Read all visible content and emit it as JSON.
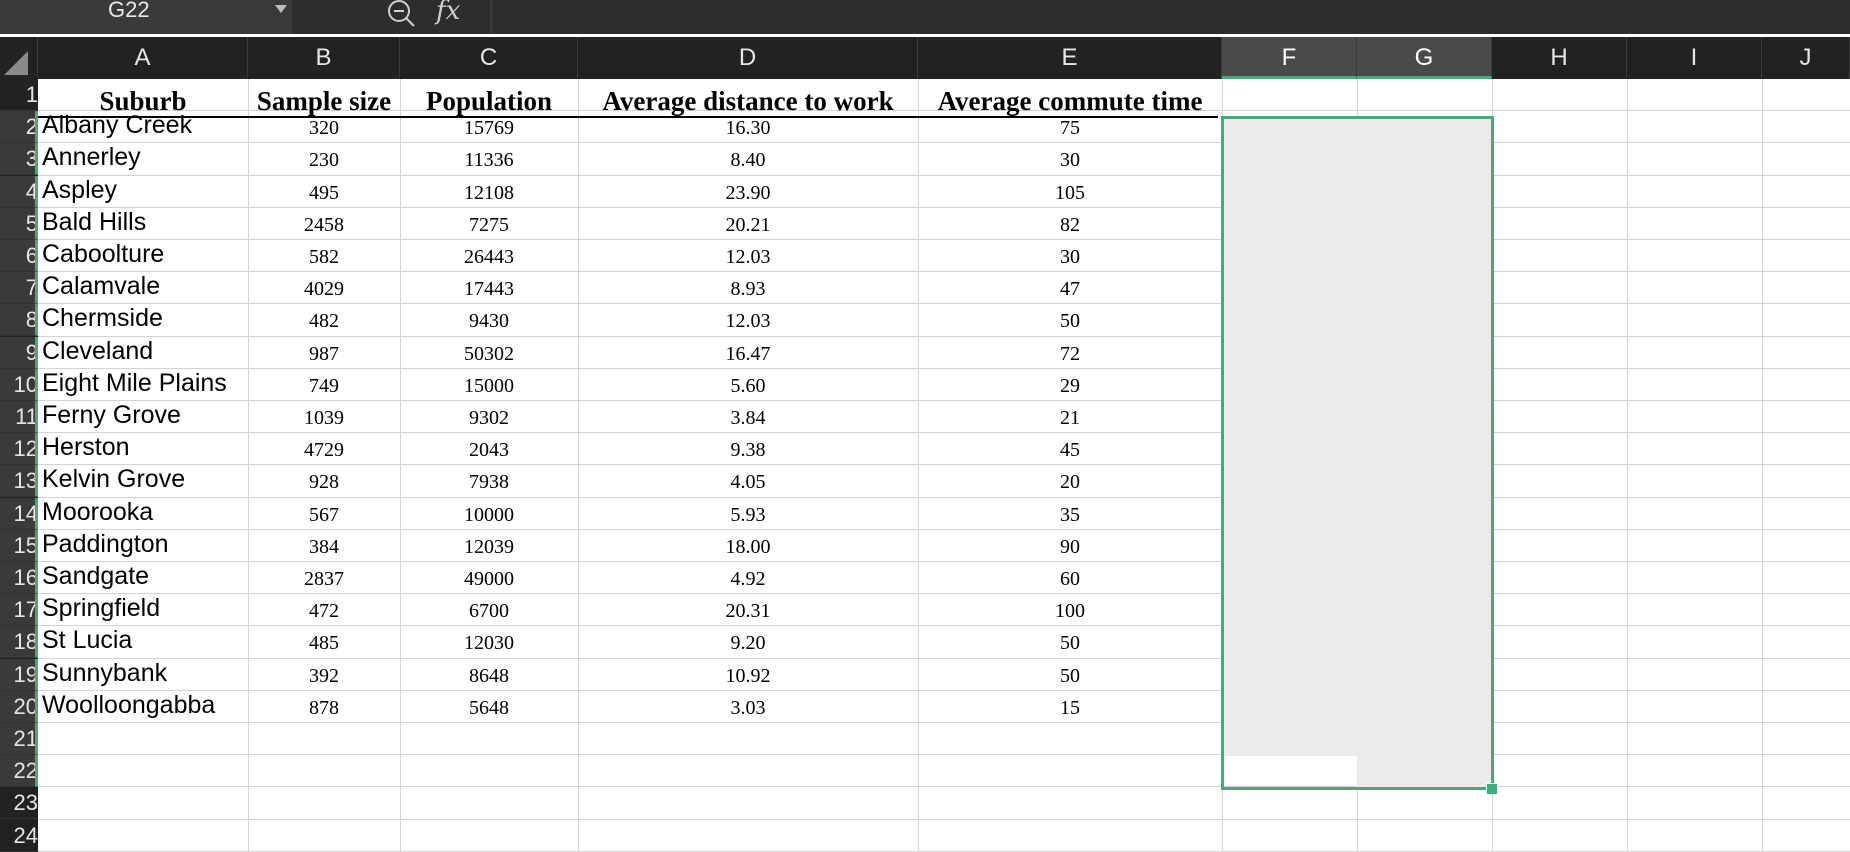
{
  "formula_bar": {
    "name_box": "G22",
    "fx_label": "fx",
    "zoom_icon": "zoom-icon",
    "formula_value": ""
  },
  "columns": [
    "A",
    "B",
    "C",
    "D",
    "E",
    "F",
    "G",
    "H",
    "I",
    "J"
  ],
  "selected_columns": [
    "F",
    "G"
  ],
  "rows": [
    "1",
    "2",
    "3",
    "4",
    "5",
    "6",
    "7",
    "8",
    "9",
    "10",
    "11",
    "12",
    "13",
    "14",
    "15",
    "16",
    "17",
    "18",
    "19",
    "20",
    "21",
    "22",
    "23",
    "24"
  ],
  "selected_rows": [
    "2",
    "3",
    "4",
    "5",
    "6",
    "7",
    "8",
    "9",
    "10",
    "11",
    "12",
    "13",
    "14",
    "15",
    "16",
    "17",
    "18",
    "19",
    "20",
    "21",
    "22"
  ],
  "selection": {
    "range": "F2:G22",
    "active_cell": "G22",
    "accent_color": "#3fae7d",
    "fill_color": "#ebebeb"
  },
  "table": {
    "headers": [
      "Suburb",
      "Sample size",
      "Population",
      "Average distance to work",
      "Average commute time"
    ],
    "rows": [
      [
        "Albany Creek",
        "320",
        "15769",
        "16.30",
        "75"
      ],
      [
        "Annerley",
        "230",
        "11336",
        "8.40",
        "30"
      ],
      [
        "Aspley",
        "495",
        "12108",
        "23.90",
        "105"
      ],
      [
        "Bald Hills",
        "2458",
        "7275",
        "20.21",
        "82"
      ],
      [
        "Caboolture",
        "582",
        "26443",
        "12.03",
        "30"
      ],
      [
        "Calamvale",
        "4029",
        "17443",
        "8.93",
        "47"
      ],
      [
        "Chermside",
        "482",
        "9430",
        "12.03",
        "50"
      ],
      [
        "Cleveland",
        "987",
        "50302",
        "16.47",
        "72"
      ],
      [
        "Eight Mile Plains",
        "749",
        "15000",
        "5.60",
        "29"
      ],
      [
        "Ferny Grove",
        "1039",
        "9302",
        "3.84",
        "21"
      ],
      [
        "Herston",
        "4729",
        "2043",
        "9.38",
        "45"
      ],
      [
        "Kelvin Grove",
        "928",
        "7938",
        "4.05",
        "20"
      ],
      [
        "Moorooka",
        "567",
        "10000",
        "5.93",
        "35"
      ],
      [
        "Paddington",
        "384",
        "12039",
        "18.00",
        "90"
      ],
      [
        "Sandgate",
        "2837",
        "49000",
        "4.92",
        "60"
      ],
      [
        "Springfield",
        "472",
        "6700",
        "20.31",
        "100"
      ],
      [
        "St Lucia",
        "485",
        "12030",
        "9.20",
        "50"
      ],
      [
        "Sunnybank",
        "392",
        "8648",
        "10.92",
        "50"
      ],
      [
        "Woolloongabba",
        "878",
        "5648",
        "3.03",
        "15"
      ]
    ]
  }
}
